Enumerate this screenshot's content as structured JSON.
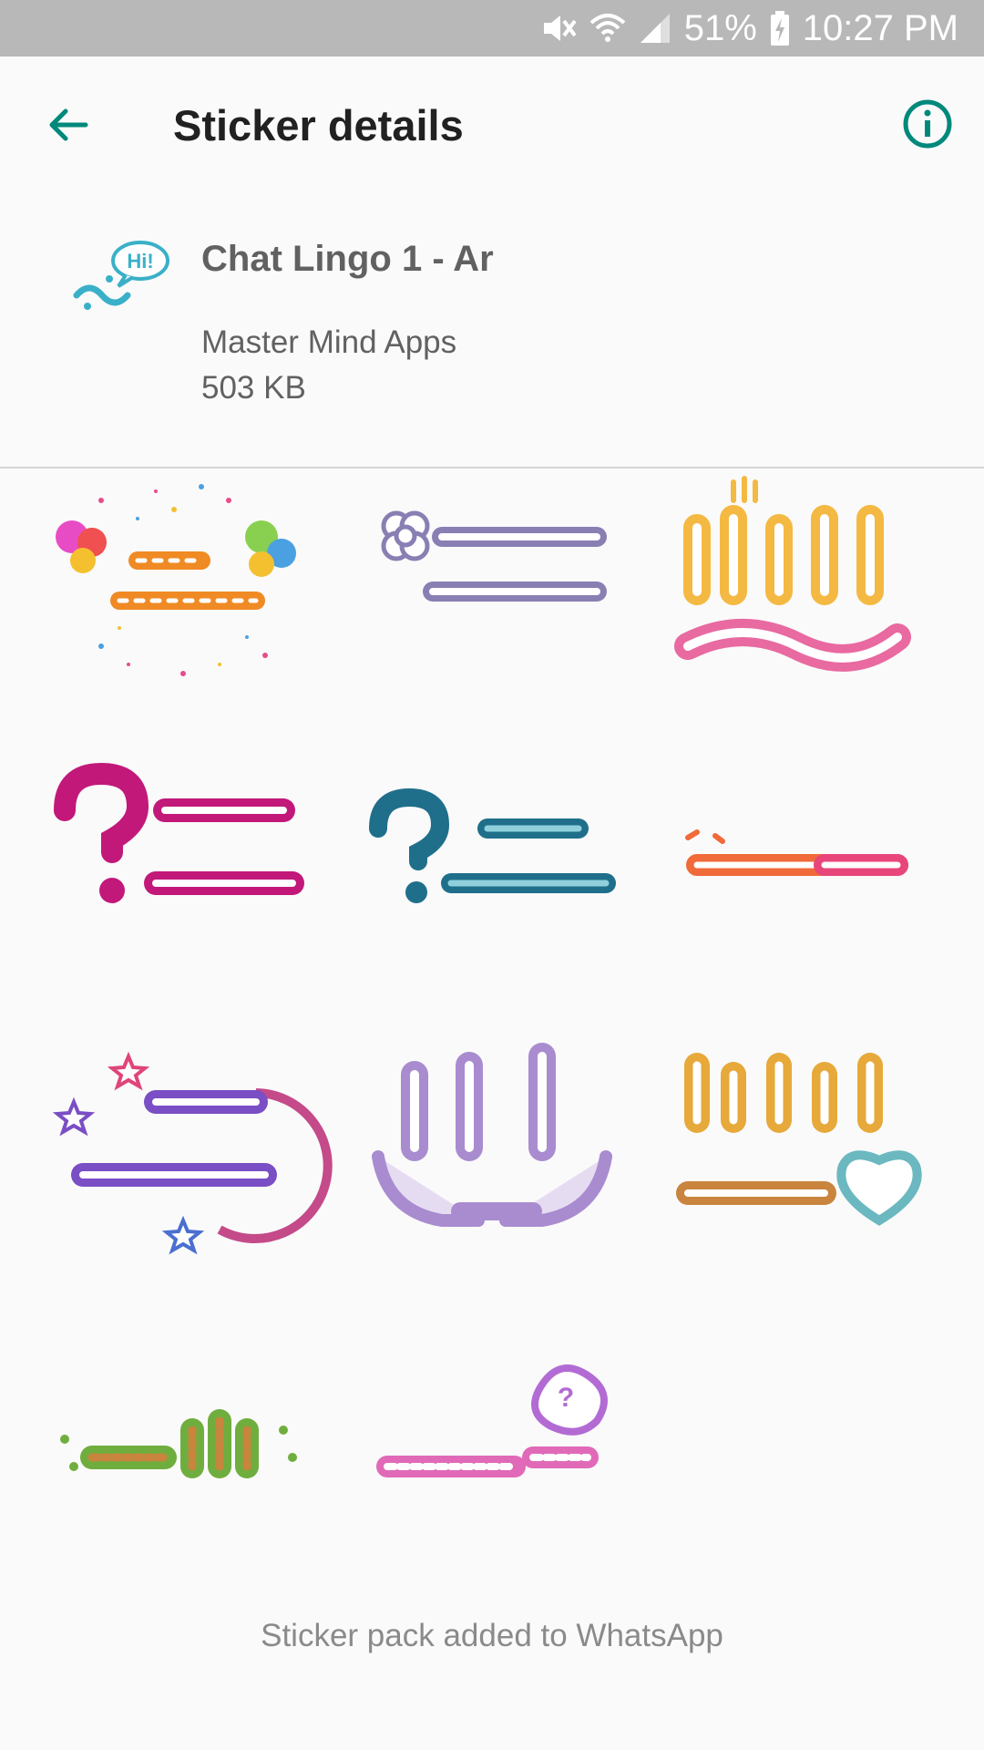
{
  "status_bar": {
    "battery": "51%",
    "time": "10:27 PM",
    "icons": [
      "mute-icon",
      "wifi-icon",
      "signal-icon",
      "battery-charging-icon"
    ]
  },
  "app_bar": {
    "title": "Sticker details",
    "back_icon": "arrow-left-icon",
    "info_icon": "info-icon"
  },
  "pack": {
    "name": "Chat Lingo 1 - Ar",
    "publisher": "Master Mind Apps",
    "size": "503 KB",
    "tray_icon": "tray-icon",
    "tray_text": "Hi!"
  },
  "stickers": [
    {
      "label": "sticker-birthday",
      "icon": "birthday-balloons-sticker",
      "colors": [
        "#f08a24",
        "#e84c8a"
      ]
    },
    {
      "label": "sticker-wish-good-day",
      "icon": "flower-sticker",
      "colors": [
        "#8a7fb3",
        "#b0a8d0"
      ]
    },
    {
      "label": "sticker-salam",
      "icon": "salam-sticker",
      "colors": [
        "#f4b942",
        "#e86aa0"
      ]
    },
    {
      "label": "sticker-how-are-you",
      "icon": "question-sticker",
      "colors": [
        "#c2187a",
        "#e04aa8"
      ]
    },
    {
      "label": "sticker-how-was-your-day",
      "icon": "question-sticker",
      "colors": [
        "#1f6f8b",
        "#2c9fb0"
      ]
    },
    {
      "label": "sticker-good",
      "icon": "text-sticker",
      "colors": [
        "#f06a3a",
        "#e8457a"
      ]
    },
    {
      "label": "sticker-sweet-dreams",
      "icon": "stars-moon-sticker",
      "colors": [
        "#7a4ec4",
        "#e0457a"
      ]
    },
    {
      "label": "sticker-take-care",
      "icon": "hands-sticker",
      "colors": [
        "#a98ccf",
        "#c7b2e4"
      ]
    },
    {
      "label": "sticker-thank-you",
      "icon": "heart-sticker",
      "colors": [
        "#e6a93a",
        "#6bb8c0"
      ]
    },
    {
      "label": "sticker-welcome",
      "icon": "text-sticker",
      "colors": [
        "#6fae3e",
        "#c9843d"
      ]
    },
    {
      "label": "sticker-whats-up",
      "icon": "bubble-sticker",
      "colors": [
        "#b36bd4",
        "#e06ab8"
      ]
    }
  ],
  "footer": {
    "text": "Sticker pack added to WhatsApp"
  },
  "colors": {
    "accent": "#00897b",
    "status_bar": "#b8b8b8"
  }
}
